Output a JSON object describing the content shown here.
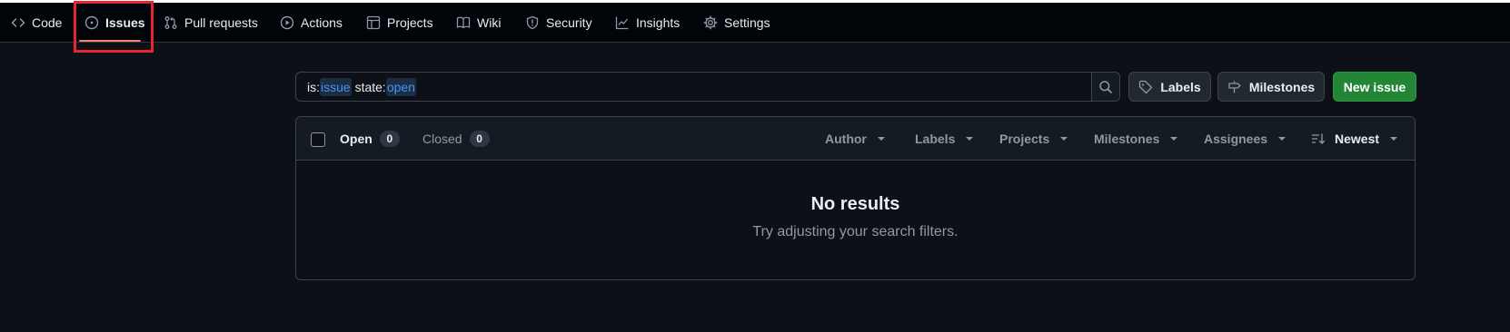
{
  "nav": {
    "items": [
      {
        "label": "Code",
        "icon": "code-icon"
      },
      {
        "label": "Issues",
        "icon": "issue-opened-icon",
        "active": true
      },
      {
        "label": "Pull requests",
        "icon": "git-pull-request-icon"
      },
      {
        "label": "Actions",
        "icon": "play-icon"
      },
      {
        "label": "Projects",
        "icon": "table-icon"
      },
      {
        "label": "Wiki",
        "icon": "book-icon"
      },
      {
        "label": "Security",
        "icon": "shield-icon"
      },
      {
        "label": "Insights",
        "icon": "graph-icon"
      },
      {
        "label": "Settings",
        "icon": "gear-icon"
      }
    ]
  },
  "search": {
    "tokens": [
      {
        "key": "is:",
        "value": "issue"
      },
      {
        "key": "state:",
        "value": "open"
      }
    ]
  },
  "buttons": {
    "labels": "Labels",
    "milestones": "Milestones",
    "new_issue": "New issue"
  },
  "issues": {
    "open_label": "Open",
    "open_count": "0",
    "closed_label": "Closed",
    "closed_count": "0",
    "filters": {
      "author": "Author",
      "labels": "Labels",
      "projects": "Projects",
      "milestones": "Milestones",
      "assignees": "Assignees",
      "sort": "Newest"
    },
    "empty_title": "No results",
    "empty_subtitle": "Try adjusting your search filters."
  },
  "colors": {
    "accent_underline": "#f78166",
    "primary_button": "#238636",
    "highlight": "#e5262c",
    "token": "#4493f8"
  }
}
